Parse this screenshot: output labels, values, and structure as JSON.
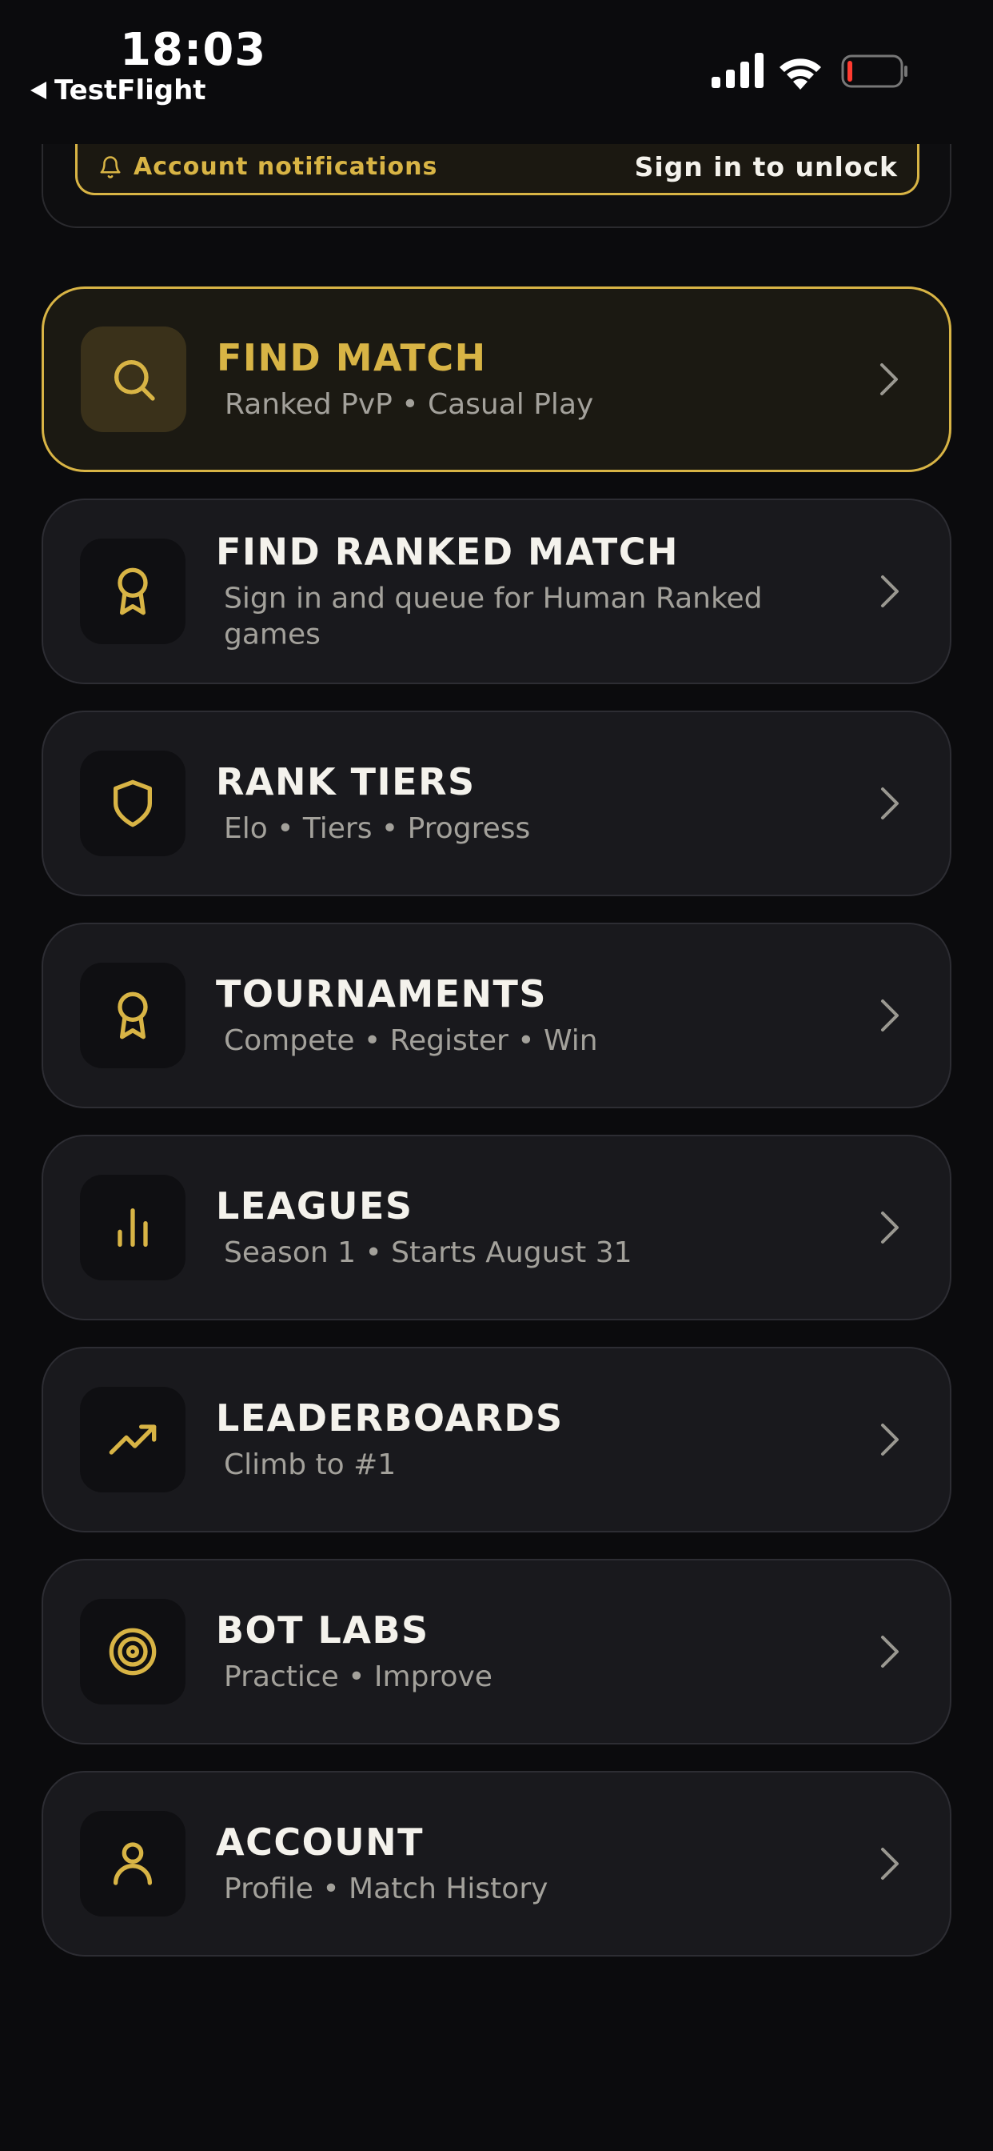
{
  "status_bar": {
    "time": "18:03",
    "back_app": "TestFlight"
  },
  "notifications": {
    "label": "Account notifications",
    "action": "Sign in to unlock",
    "icon": "bell-icon"
  },
  "accent_color": "#d8b445",
  "menu": {
    "items": [
      {
        "title": "FIND MATCH",
        "subtitle": "Ranked PvP • Casual Play",
        "icon": "search-icon",
        "active": true
      },
      {
        "title": "FIND RANKED MATCH",
        "subtitle": "Sign in and queue for Human Ranked games",
        "icon": "award-icon"
      },
      {
        "title": "RANK TIERS",
        "subtitle": "Elo • Tiers • Progress",
        "icon": "shield-icon"
      },
      {
        "title": "TOURNAMENTS",
        "subtitle": "Compete • Register • Win",
        "icon": "award-icon"
      },
      {
        "title": "LEAGUES",
        "subtitle": "Season 1 • Starts August 31",
        "icon": "bar-chart-icon"
      },
      {
        "title": "LEADERBOARDS",
        "subtitle": "Climb to #1",
        "icon": "trending-up-icon"
      },
      {
        "title": "BOT LABS",
        "subtitle": "Practice • Improve",
        "icon": "target-icon"
      },
      {
        "title": "ACCOUNT",
        "subtitle": "Profile • Match History",
        "icon": "user-icon"
      }
    ]
  }
}
